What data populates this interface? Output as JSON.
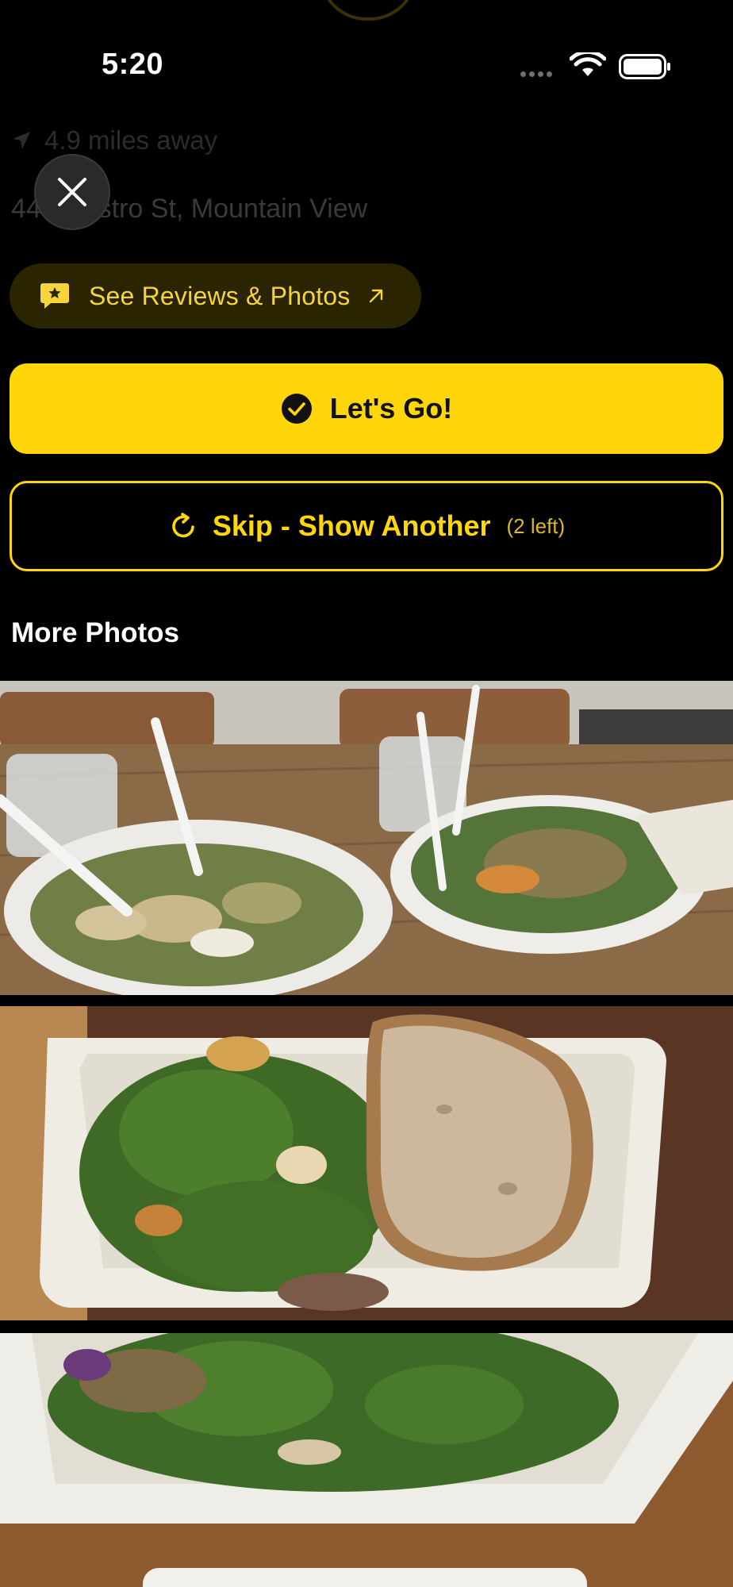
{
  "status_bar": {
    "time": "5:20"
  },
  "venue": {
    "distance": "4.9 miles away",
    "address": "449 Castro St, Mountain View"
  },
  "actions": {
    "reviews_label": "See Reviews & Photos",
    "go_label": "Let's Go!",
    "skip_label": "Skip - Show Another",
    "skip_count": "(2 left)"
  },
  "photos_section": {
    "title": "More Photos",
    "photos": [
      {
        "alt": "two salad bowls on wooden table"
      },
      {
        "alt": "kale salad bowl with bread slice"
      },
      {
        "alt": "kale salad in takeout bowl"
      }
    ]
  },
  "colors": {
    "accent": "#ffd60a",
    "background": "#000000",
    "pill_background": "#2b2400"
  },
  "icons": [
    "location-arrow-icon",
    "close-icon",
    "chat-star-icon",
    "external-arrow-icon",
    "check-circle-icon",
    "refresh-icon",
    "wifi-icon",
    "battery-icon"
  ]
}
